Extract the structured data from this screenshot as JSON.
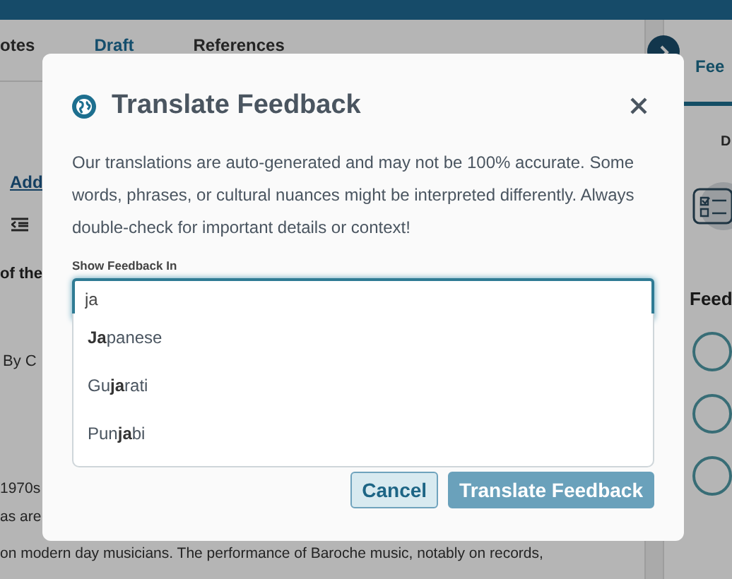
{
  "app": {
    "tabs": [
      {
        "label": "otes",
        "selected": false
      },
      {
        "label": "Draft",
        "selected": true
      },
      {
        "label": "References",
        "selected": false
      }
    ],
    "add_link": "Add",
    "heading": "of the",
    "byline": "By C",
    "paragraph_lines": [
      "1970s",
      "as are",
      "on modern day musicians.  The performance of Baroche music, notably on records,"
    ],
    "side_panel": {
      "tab": "Fee",
      "subtab": "D",
      "section_title": "Feed"
    }
  },
  "dialog": {
    "title": "Translate Feedback",
    "message": "Our translations are auto-generated and may not be 100% accurate. Some words, phrases, or cultural nuances might be interpreted differently. Always double-check for important details or context!",
    "field": {
      "label": "Show Feedback In",
      "value": "ja"
    },
    "options": [
      {
        "label": "**Ja**panese"
      },
      {
        "label": "Gu**ja**rati"
      },
      {
        "label": "Pun**ja**bi"
      }
    ],
    "buttons": [
      {
        "label": "Cancel",
        "kind": "secondary"
      },
      {
        "label": "Translate Feedback",
        "kind": "primary"
      }
    ]
  }
}
